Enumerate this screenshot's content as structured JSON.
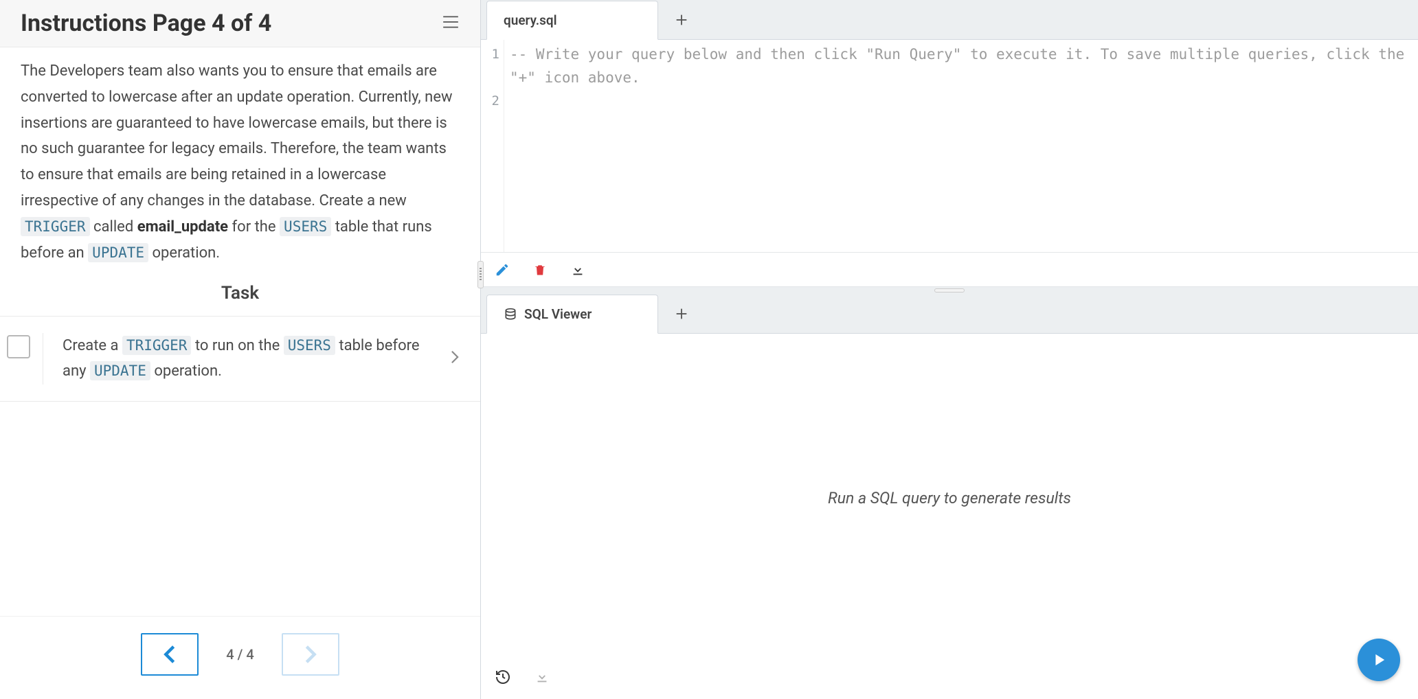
{
  "instructions": {
    "title": "Instructions Page 4 of 4",
    "paragraph_parts": [
      "The Developers team also wants you to ensure that emails are converted to lowercase after an update operation. Currently, new insertions are guaranteed to have lowercase emails, but there is no such guarantee for legacy emails. Therefore, the team wants to ensure that emails are being retained in a lowercase irrespective of any changes in the database. Create a new ",
      "TRIGGER",
      " called ",
      "email_update",
      " for the ",
      "USERS",
      " table that runs before an ",
      "UPDATE",
      " operation."
    ],
    "task_heading": "Task",
    "task": {
      "parts": [
        "Create a ",
        "TRIGGER",
        " to run on the ",
        "USERS",
        " table before any ",
        "UPDATE",
        " operation."
      ]
    },
    "page_indicator": "4 / 4"
  },
  "editor": {
    "tab_label": "query.sql",
    "lines": [
      "1",
      "2"
    ],
    "comment": "-- Write your query below and then click \"Run Query\" to execute it. To save multiple queries, click the \"+\" icon above."
  },
  "viewer": {
    "tab_label": "SQL Viewer",
    "empty_message": "Run a SQL query to generate results"
  },
  "icons": {
    "menu": "menu-icon",
    "plus": "plus-icon",
    "pencil": "pencil-icon",
    "trash": "trash-icon",
    "download": "download-icon",
    "history": "history-icon",
    "database": "database-icon",
    "chevron_right": "chevron-right-icon",
    "chevron_left": "chevron-left-icon",
    "play": "play-icon"
  },
  "colors": {
    "accent": "#2b90d9",
    "danger": "#e03a3e",
    "code_bg": "#eef0f2",
    "code_fg": "#3a7391"
  }
}
